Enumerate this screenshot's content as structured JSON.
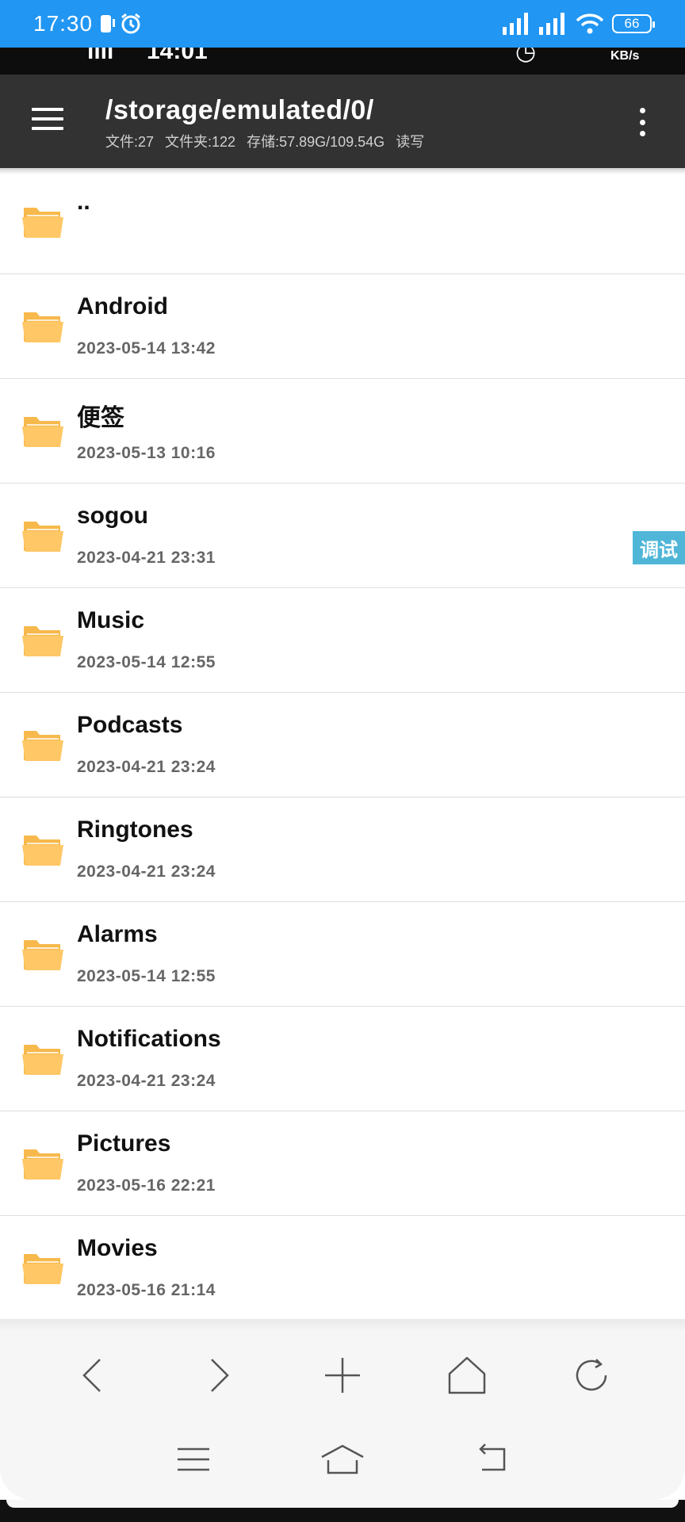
{
  "status_bar": {
    "time": "17:30",
    "battery": "66",
    "icons": [
      "phone-icon",
      "alarm-icon",
      "signal-icon",
      "signal-icon",
      "wifi-icon",
      "battery-icon"
    ]
  },
  "header": {
    "path": "/storage/emulated/0/",
    "stats": {
      "files": "文件:27",
      "folders": "文件夹:122",
      "storage": "存储:57.89G/109.54G",
      "mode": "读写"
    }
  },
  "files": [
    {
      "name": "..",
      "date": ""
    },
    {
      "name": "Android",
      "date": "2023-05-14  13:42"
    },
    {
      "name": "便签",
      "date": "2023-05-13  10:16"
    },
    {
      "name": "sogou",
      "date": "2023-04-21  23:31"
    },
    {
      "name": "Music",
      "date": "2023-05-14  12:55"
    },
    {
      "name": "Podcasts",
      "date": "2023-04-21  23:24"
    },
    {
      "name": "Ringtones",
      "date": "2023-04-21  23:24"
    },
    {
      "name": "Alarms",
      "date": "2023-05-14  12:55"
    },
    {
      "name": "Notifications",
      "date": "2023-04-21  23:24"
    },
    {
      "name": "Pictures",
      "date": "2023-05-16  22:21"
    },
    {
      "name": "Movies",
      "date": "2023-05-16  21:14"
    }
  ],
  "debug_tab": "调试",
  "colors": {
    "status_bar": "#2196F3",
    "header": "#323232",
    "folder": "#FFC766",
    "debug_tab": "#4FB6D8"
  }
}
